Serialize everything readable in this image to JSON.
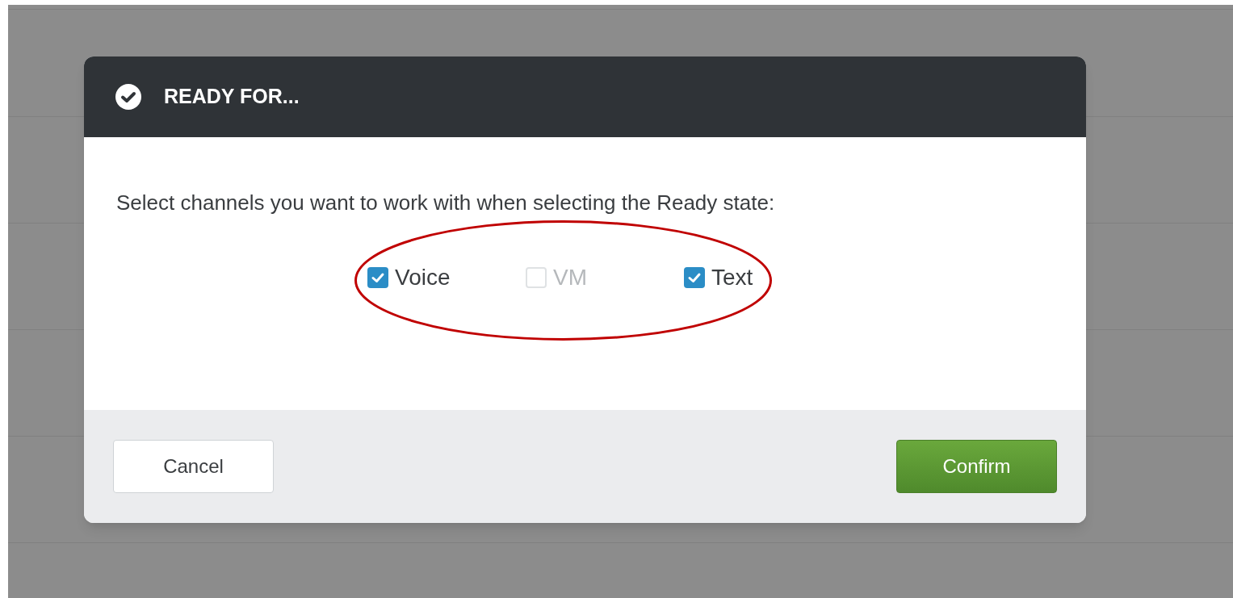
{
  "dialog": {
    "title": "READY FOR...",
    "prompt": "Select channels you want to work with when selecting the Ready state:",
    "channels": [
      {
        "label": "Voice",
        "checked": true,
        "disabled": false
      },
      {
        "label": "VM",
        "checked": false,
        "disabled": true
      },
      {
        "label": "Text",
        "checked": true,
        "disabled": false
      }
    ],
    "buttons": [
      {
        "label": "Cancel",
        "kind": "secondary"
      },
      {
        "label": "Confirm",
        "kind": "primary"
      }
    ]
  }
}
